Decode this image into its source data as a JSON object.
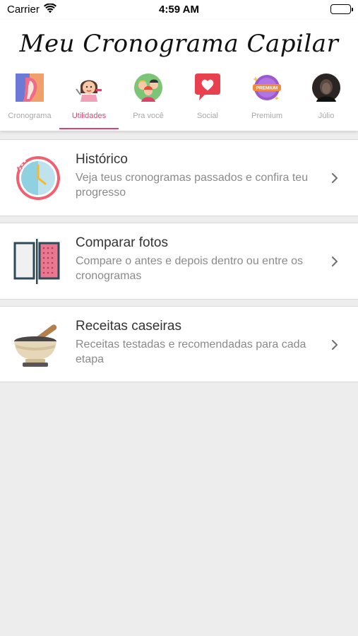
{
  "status_bar": {
    "carrier": "Carrier",
    "time": "4:59 AM"
  },
  "header": {
    "title": "Meu Cronograma Capilar"
  },
  "tabs": [
    {
      "label": "Cronograma",
      "icon": "hair-profile-icon",
      "active": false
    },
    {
      "label": "Utilidades",
      "icon": "hair-salon-icon",
      "active": true
    },
    {
      "label": "Pra você",
      "icon": "people-group-icon",
      "active": false
    },
    {
      "label": "Social",
      "icon": "heart-chat-icon",
      "active": false
    },
    {
      "label": "Premium",
      "icon": "premium-badge-icon",
      "active": false
    },
    {
      "label": "Júlio",
      "icon": "avatar",
      "active": false
    }
  ],
  "premium_badge_text": "PREMIUM",
  "cards": [
    {
      "title": "Histórico",
      "description": "Veja teus cronogramas passados e confira teu progresso",
      "icon": "clock-history-icon"
    },
    {
      "title": "Comparar fotos",
      "description": "Compare o antes e depois dentro ou entre os cronogramas",
      "icon": "compare-photos-icon"
    },
    {
      "title": "Receitas caseiras",
      "description": "Receitas testadas e recomendadas para cada etapa",
      "icon": "mortar-pestle-icon"
    }
  ],
  "colors": {
    "accent": "#e0416b",
    "background": "#ededed",
    "card": "#ffffff",
    "inactive_tab": "#a9a9a9"
  }
}
